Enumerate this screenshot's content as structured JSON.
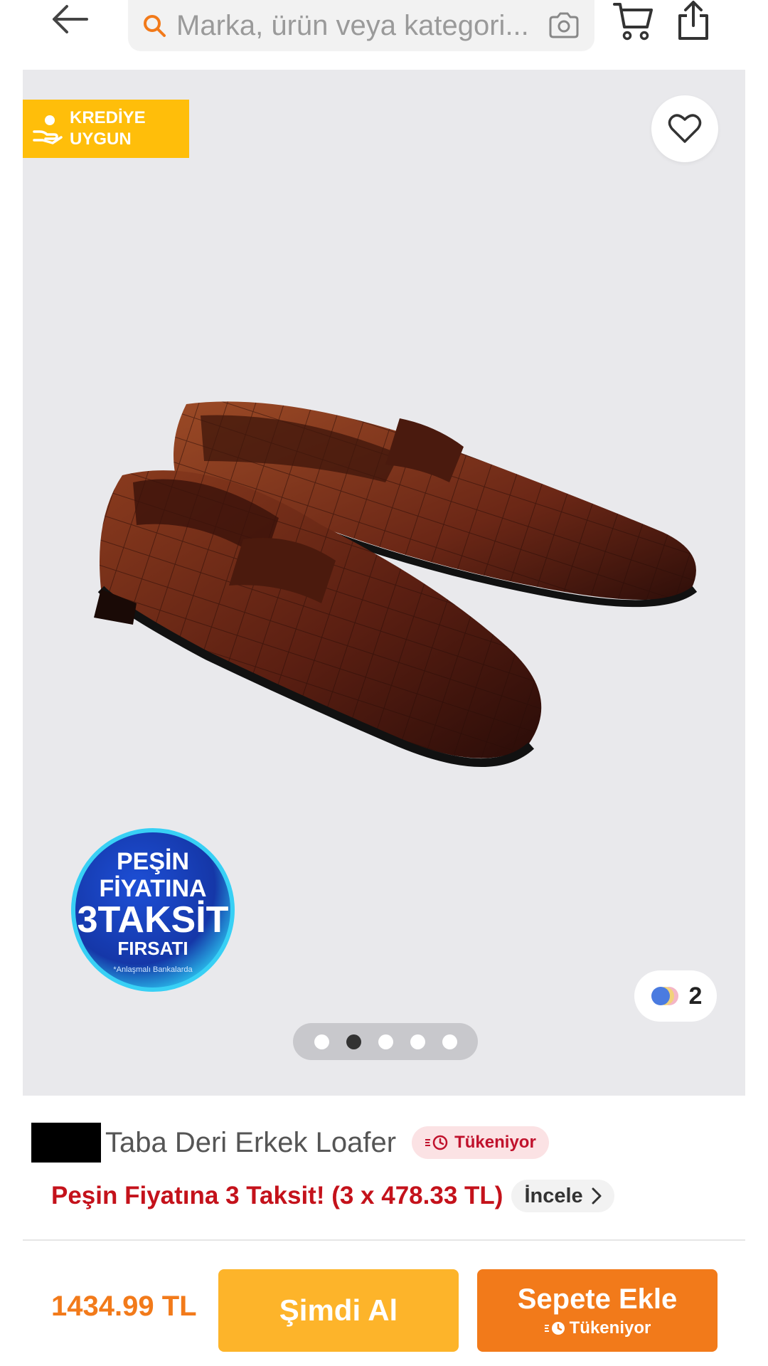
{
  "header": {
    "search_placeholder": "Marka, ürün veya kategori..."
  },
  "product": {
    "credit_badge_line1": "KREDİYE",
    "credit_badge_line2": "UYGUN",
    "variant_count": "2",
    "image_count": 5,
    "active_image_index": 1,
    "title": "Taba Deri Erkek Loafer",
    "stock_badge": "Tükeniyor",
    "installment_text": "Peşin Fiyatına 3 Taksit! (3 x 478.33 TL)",
    "installment_link": "İncele",
    "promo_sticker": {
      "line1": "PEŞİN",
      "line2": "FİYATINA",
      "line3": "3TAKSİT",
      "line4": "FIRSATI",
      "footnote": "*Anlaşmalı Bankalarda"
    }
  },
  "bottom_bar": {
    "price": "1434.99 TL",
    "buy_now_label": "Şimdi Al",
    "add_to_cart_label": "Sepete Ekle",
    "add_to_cart_sub": "Tükeniyor"
  },
  "colors": {
    "accent_orange": "#f27a1a",
    "buy_now_yellow": "#fdb42a",
    "credit_badge": "#ffbe0a",
    "installment_red": "#c4121b"
  }
}
